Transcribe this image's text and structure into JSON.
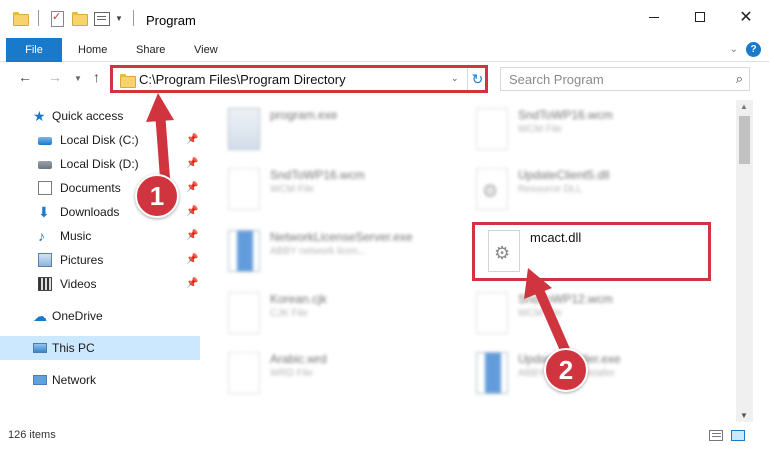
{
  "window": {
    "title": "Program",
    "controls": [
      "minimize",
      "maximize",
      "close"
    ]
  },
  "ribbon": {
    "tabs": [
      {
        "label": "File"
      },
      {
        "label": "Home"
      },
      {
        "label": "Share"
      },
      {
        "label": "View"
      }
    ],
    "help_label": "?"
  },
  "address": {
    "path": "C:\\Program Files\\Program Directory",
    "search_placeholder": "Search Program"
  },
  "nav_pane": {
    "quick_access": "Quick access",
    "items": [
      {
        "label": "Local Disk (C:)",
        "icon": "drive-icon",
        "pinned": true
      },
      {
        "label": "Local Disk (D:)",
        "icon": "drive-icon",
        "pinned": true
      },
      {
        "label": "Documents",
        "icon": "documents-icon",
        "pinned": true
      },
      {
        "label": "Downloads",
        "icon": "downloads-icon",
        "pinned": true
      },
      {
        "label": "Music",
        "icon": "music-icon",
        "pinned": true
      },
      {
        "label": "Pictures",
        "icon": "pictures-icon",
        "pinned": true
      },
      {
        "label": "Videos",
        "icon": "videos-icon",
        "pinned": true
      }
    ],
    "onedrive": "OneDrive",
    "this_pc": "This PC",
    "network": "Network"
  },
  "files": [
    {
      "name": "program.exe",
      "type": "",
      "blurred": true
    },
    {
      "name": "SndToWP16.wcm",
      "type": "WCM File",
      "blurred": true
    },
    {
      "name": "SndToWP16.wcm",
      "type": "WCM File",
      "blurred": true
    },
    {
      "name": "UpdateClient5.dll",
      "type": "Resource DLL",
      "blurred": true
    },
    {
      "name": "NetworkLicenseServer.exe",
      "type": "ABBY network licen...",
      "blurred": true
    },
    {
      "name": "mcact.dll",
      "type": "",
      "blurred": false
    },
    {
      "name": "Korean.cjk",
      "type": "CJK File",
      "blurred": true
    },
    {
      "name": "SndToWP12.wcm",
      "type": "WCM File",
      "blurred": true
    },
    {
      "name": "Arabic.wrd",
      "type": "WRD File",
      "blurred": true
    },
    {
      "name": "UpdateInstaller.exe",
      "type": "ABBY update installer",
      "blurred": true
    }
  ],
  "status": {
    "item_count": "126 items"
  },
  "callouts": {
    "step1": "1",
    "step2": "2"
  },
  "colors": {
    "accent": "#1979ca",
    "highlight_red": "#d0353f",
    "selected_bg": "#cce8ff"
  }
}
